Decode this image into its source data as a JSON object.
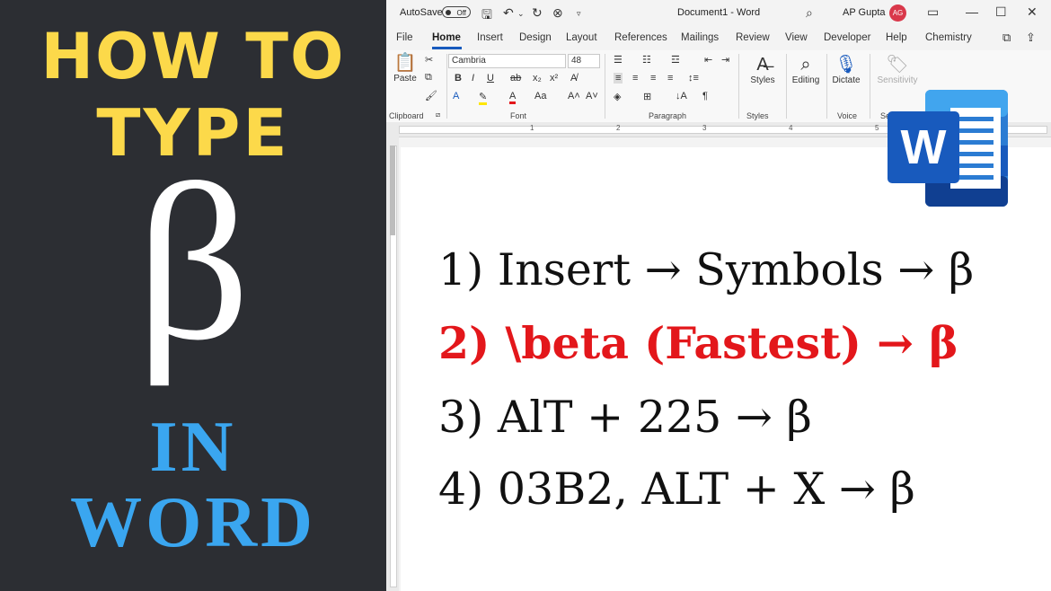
{
  "thumbnail": {
    "heading_line1": "HOW TO",
    "heading_line2": "TYPE",
    "symbol": "β",
    "heading_line3": "IN",
    "heading_line4": "WORD"
  },
  "titlebar": {
    "autosave_label": "AutoSave",
    "autosave_state": "Off",
    "document_title": "Document1  -  Word",
    "user_name": "AP Gupta",
    "avatar_initials": "AG"
  },
  "tabs": [
    "File",
    "Home",
    "Insert",
    "Design",
    "Layout",
    "References",
    "Mailings",
    "Review",
    "View",
    "Developer",
    "Help",
    "Chemistry"
  ],
  "ribbon": {
    "paste_label": "Paste",
    "clipboard_group": "Clipboard",
    "font_name": "Cambria",
    "font_size": "48",
    "font_group": "Font",
    "paragraph_group": "Paragraph",
    "styles_label": "Styles",
    "styles_group": "Styles",
    "editing_label": "Editing",
    "dictate_label": "Dictate",
    "voice_group": "Voice",
    "sensitivity_label": "Sensitivity",
    "sensitivity_group": "Se"
  },
  "ruler_numbers": [
    "1",
    "2",
    "3",
    "4",
    "5"
  ],
  "document": {
    "lines": [
      "1) Insert → Symbols → β",
      "2) \\beta (Fastest) → β",
      "3) AlT + 225 → β",
      "4) 03B2, ALT + X → β"
    ]
  },
  "logo": {
    "letter": "W"
  },
  "colors": {
    "heading_yellow": "#fcd94a",
    "heading_blue": "#3aa6f0",
    "highlight_red": "#e3171b",
    "word_blue": "#185abd"
  }
}
